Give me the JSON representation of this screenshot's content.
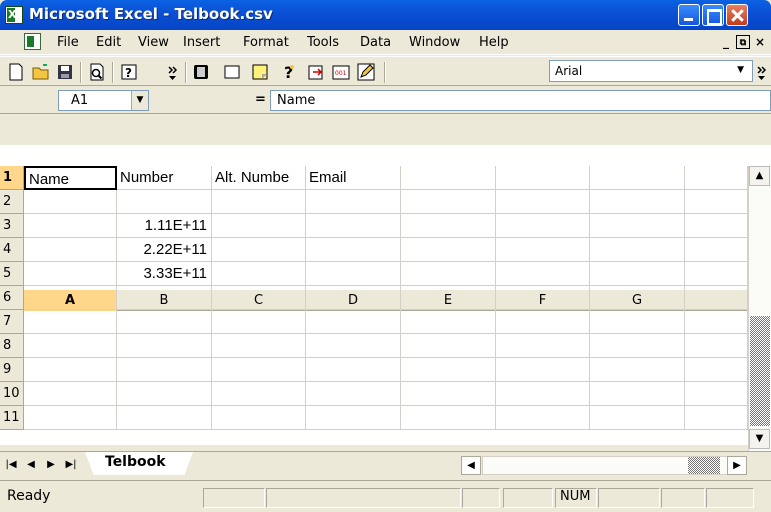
{
  "window": {
    "title": "Microsoft Excel - Telbook.csv",
    "controls": {
      "minimize": "minimize",
      "maximize": "maximize",
      "close": "close"
    }
  },
  "menubar": {
    "items": [
      {
        "label": "File"
      },
      {
        "label": "Edit"
      },
      {
        "label": "View"
      },
      {
        "label": "Insert"
      },
      {
        "label": "Format"
      },
      {
        "label": "Tools"
      },
      {
        "label": "Data"
      },
      {
        "label": "Window"
      },
      {
        "label": "Help"
      }
    ]
  },
  "toolbar": {
    "icons": [
      "new-icon",
      "open-icon",
      "save-icon",
      "print-preview-icon",
      "help-icon",
      "more-icon",
      "form-icon",
      "rectangle-icon",
      "note-icon",
      "question-icon",
      "insert-arrow-icon",
      "number-icon",
      "edit-icon"
    ],
    "font_name": "Arial"
  },
  "formula_bar": {
    "name_box": "A1",
    "equals": "=",
    "formula": "Name"
  },
  "sheet": {
    "columns": [
      "A",
      "B",
      "C",
      "D",
      "E",
      "F",
      "G"
    ],
    "rows": [
      "1",
      "2",
      "3",
      "4",
      "5",
      "6",
      "7",
      "8",
      "9",
      "10",
      "11"
    ],
    "cells": {
      "A1": "Name",
      "B1": "Number",
      "C1": "Alt. Numbe",
      "D1": "Email",
      "B3": "1.11E+11",
      "B4": "2.22E+11",
      "B5": "3.33E+11"
    },
    "active_cell": "A1"
  },
  "sheet_tabs": {
    "tabs": [
      {
        "label": "Telbook"
      }
    ]
  },
  "status_bar": {
    "status": "Ready",
    "num_indicator": "NUM"
  }
}
